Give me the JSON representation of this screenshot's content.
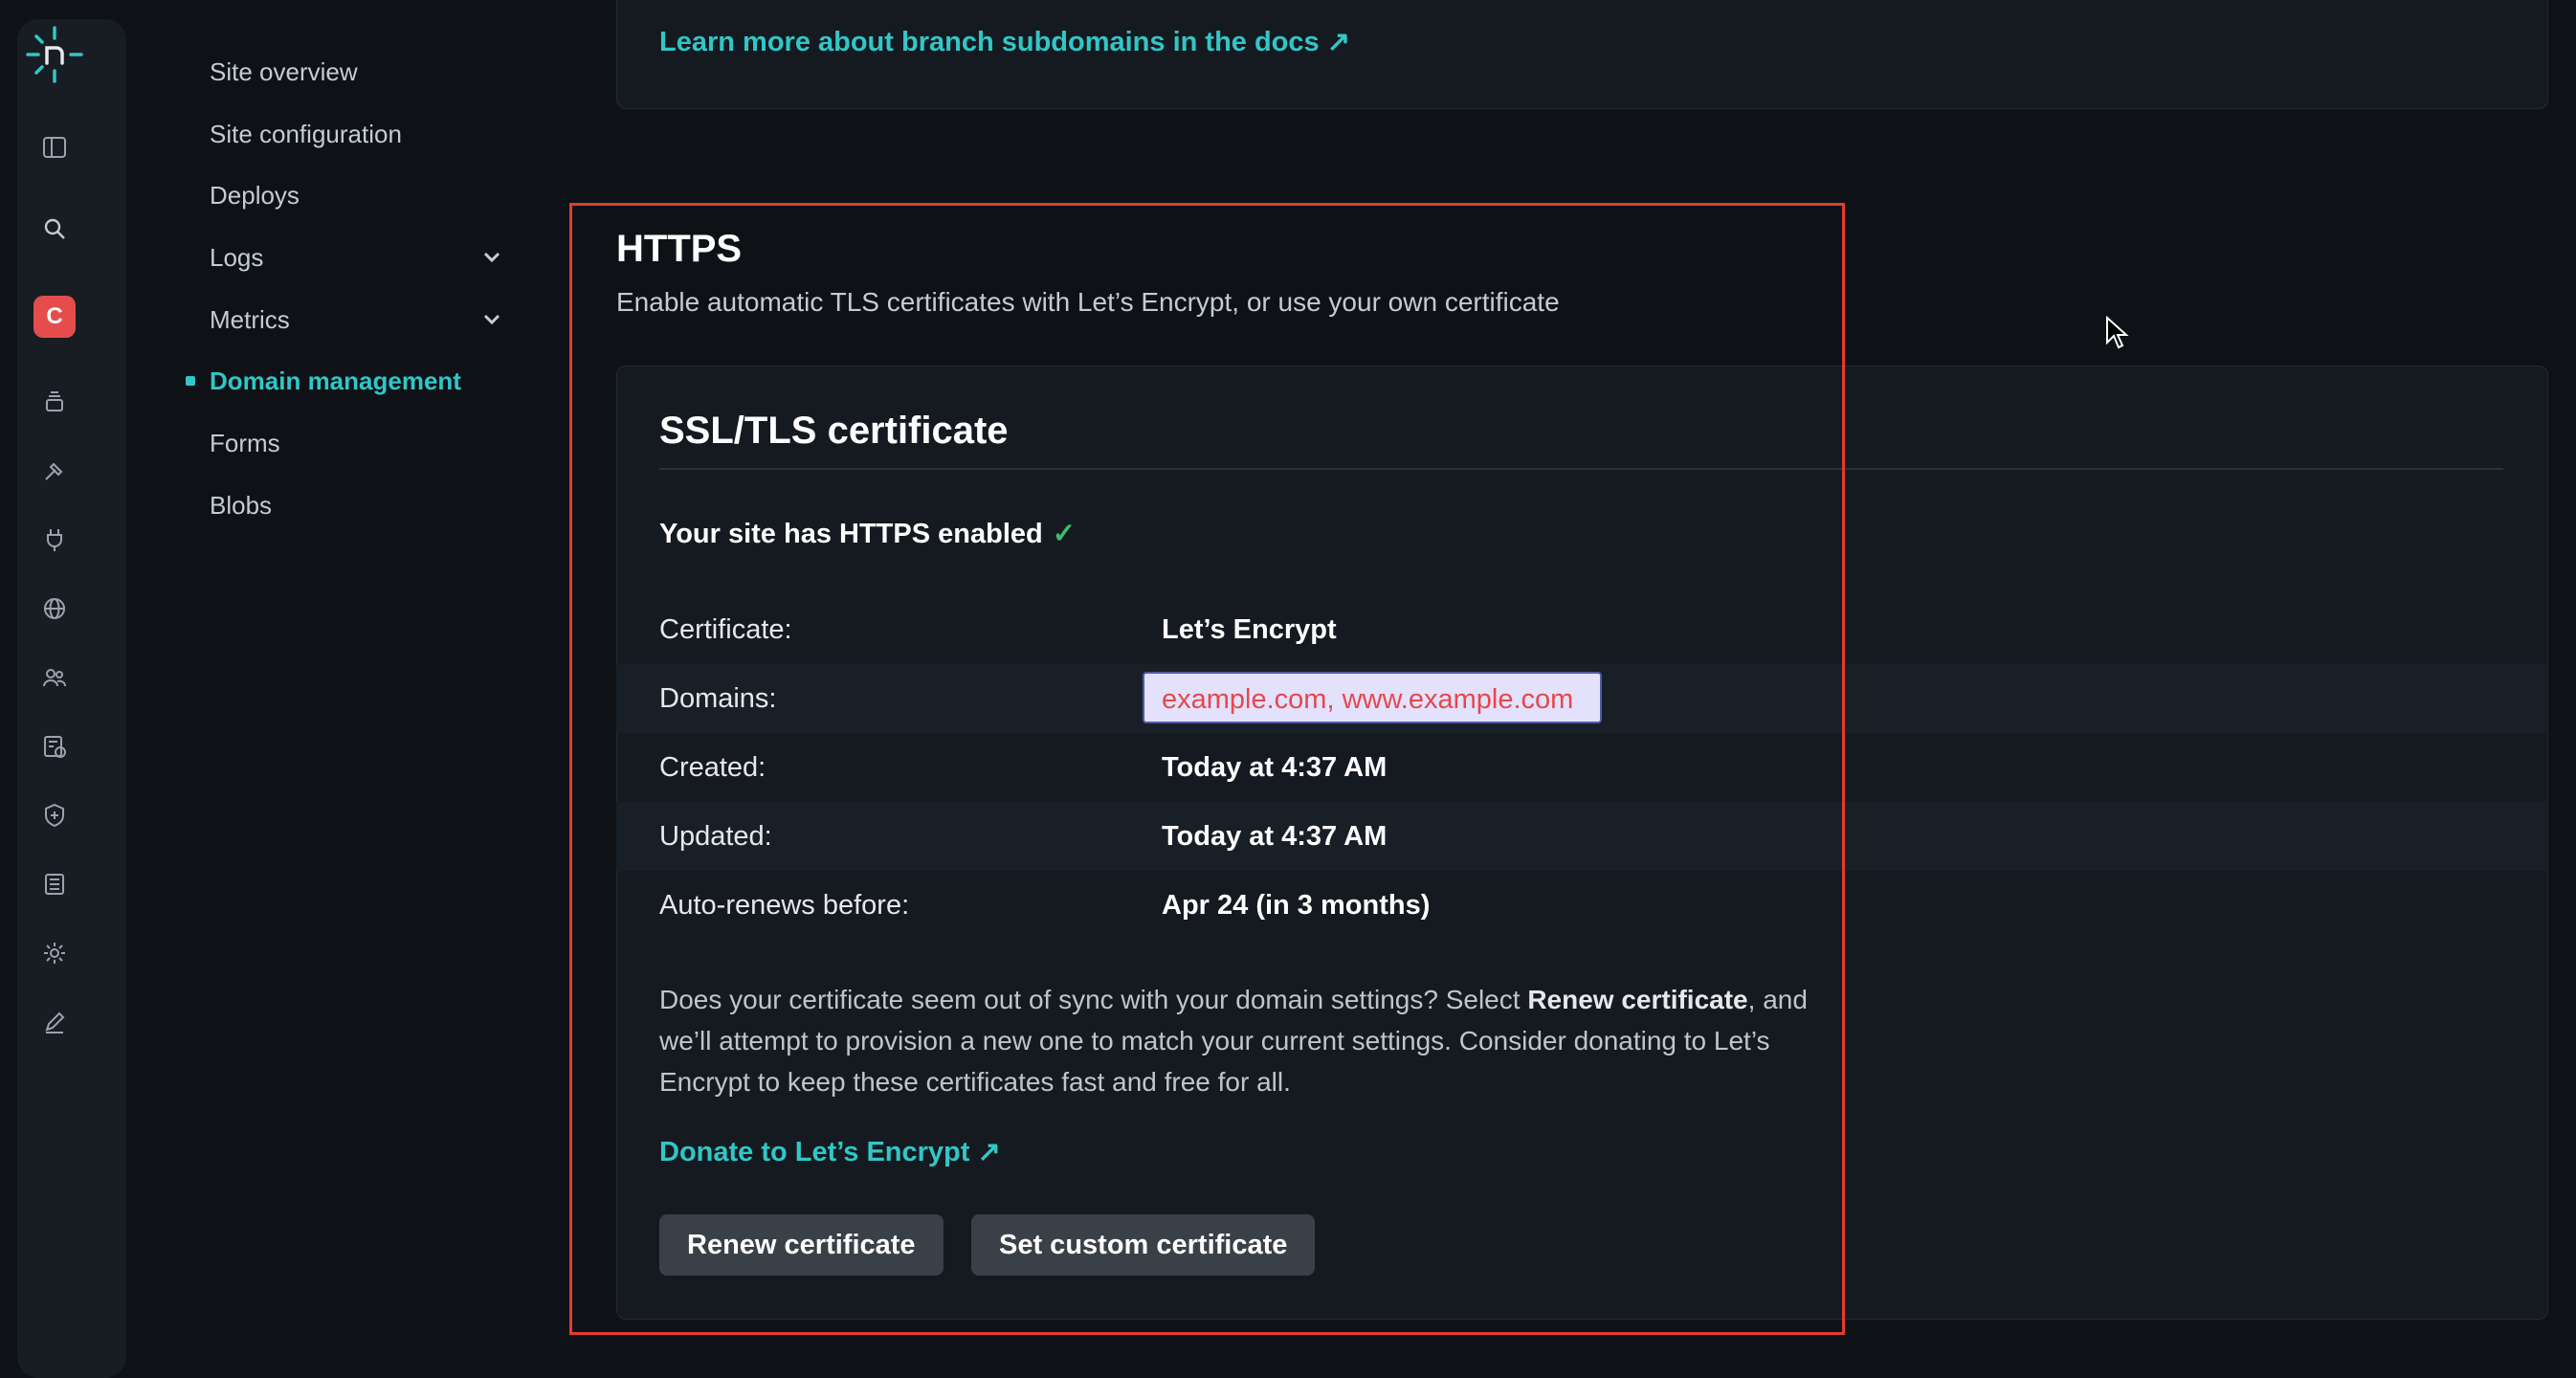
{
  "sidebar": {
    "items": [
      {
        "label": "Site overview"
      },
      {
        "label": "Site configuration"
      },
      {
        "label": "Deploys"
      },
      {
        "label": "Logs"
      },
      {
        "label": "Metrics"
      },
      {
        "label": "Domain management"
      },
      {
        "label": "Forms"
      },
      {
        "label": "Blobs"
      }
    ],
    "avatar_initial": "C"
  },
  "rail": {
    "icons": [
      "netlify-logo-icon",
      "sidebar-toggle-icon",
      "search-icon",
      "team-avatar",
      "projects-icon",
      "builds-icon",
      "integrations-icon",
      "domains-icon",
      "members-icon",
      "billing-icon",
      "security-icon",
      "audit-log-icon",
      "settings-icon",
      "edit-icon"
    ]
  },
  "top_card": {
    "link": "Learn more about branch subdomains in the docs ↗"
  },
  "https": {
    "title": "HTTPS",
    "subtitle": "Enable automatic TLS certificates with Let’s Encrypt, or use your own certificate"
  },
  "certificate_card": {
    "title": "SSL/TLS certificate",
    "status": "Your site has HTTPS enabled",
    "status_check": "✓",
    "rows": [
      {
        "label": "Certificate:",
        "value": "Let’s Encrypt"
      },
      {
        "label": "Domains:",
        "value": "example.com, www.example.com"
      },
      {
        "label": "Created:",
        "value": "Today at 4:37 AM"
      },
      {
        "label": "Updated:",
        "value": "Today at 4:37 AM"
      },
      {
        "label": "Auto-renews before:",
        "value": "Apr 24 (in 3 months)"
      }
    ],
    "paragraph_1": "Does your certificate seem out of sync with your domain settings? Select ",
    "paragraph_bold": "Renew certificate",
    "paragraph_2": ", and we’ll attempt to provision a new one to match your current settings. Consider donating to Let’s Encrypt to keep these certificates fast and free for all.",
    "donate_link": "Donate to Let’s Encrypt ↗",
    "renew_button": "Renew certificate",
    "custom_button": "Set custom certificate"
  },
  "colors": {
    "accent": "#32c6c6",
    "highlight_border": "#e33b2e",
    "domains_text": "#e5484d",
    "check": "#3fb96b"
  }
}
